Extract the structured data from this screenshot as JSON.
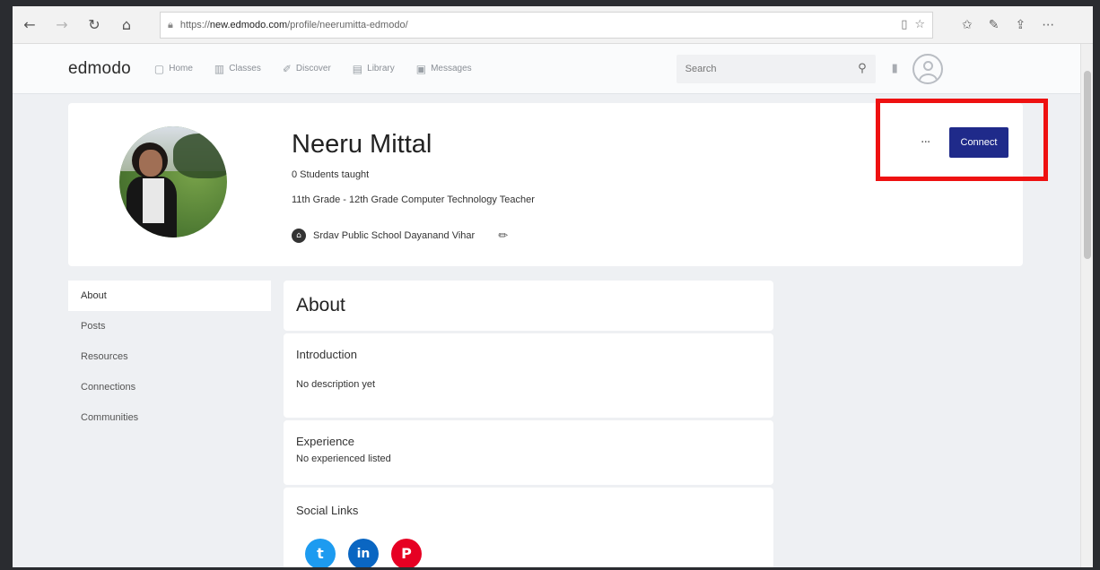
{
  "browser": {
    "url_prefix": "https://",
    "url_domain": "new.edmodo.com",
    "url_path": "/profile/neerumitta-edmodo/",
    "icons": [
      "back-icon",
      "forward-icon",
      "refresh-icon",
      "home-icon",
      "lock-icon",
      "reading-view-icon",
      "star-icon",
      "favorites-icon",
      "pen-icon",
      "share-icon",
      "more-icon"
    ]
  },
  "header": {
    "logo": "edmodo",
    "nav": [
      {
        "label": "Home",
        "icon": "home-icon"
      },
      {
        "label": "Classes",
        "icon": "classes-icon"
      },
      {
        "label": "Discover",
        "icon": "discover-icon"
      },
      {
        "label": "Library",
        "icon": "library-icon"
      },
      {
        "label": "Messages",
        "icon": "messages-icon"
      }
    ],
    "search_placeholder": "Search"
  },
  "profile": {
    "name": "Neeru Mittal",
    "students_taught": "0 Students taught",
    "role": "11th Grade - 12th Grade Computer Technology Teacher",
    "school": "Srdav Public School Dayanand Vihar",
    "more_label": "···",
    "connect_label": "Connect"
  },
  "sidebar": {
    "items": [
      {
        "label": "About",
        "active": true
      },
      {
        "label": "Posts"
      },
      {
        "label": "Resources"
      },
      {
        "label": "Connections"
      },
      {
        "label": "Communities"
      }
    ]
  },
  "about": {
    "title": "About",
    "introduction_title": "Introduction",
    "introduction_text": "No description yet",
    "experience_title": "Experience",
    "experience_text": "No experienced listed",
    "social_title": "Social Links",
    "social": [
      "twitter-icon",
      "linkedin-icon",
      "pinterest-icon"
    ]
  },
  "colors": {
    "connect": "#1f2a8a",
    "highlight": "#ee1111"
  }
}
